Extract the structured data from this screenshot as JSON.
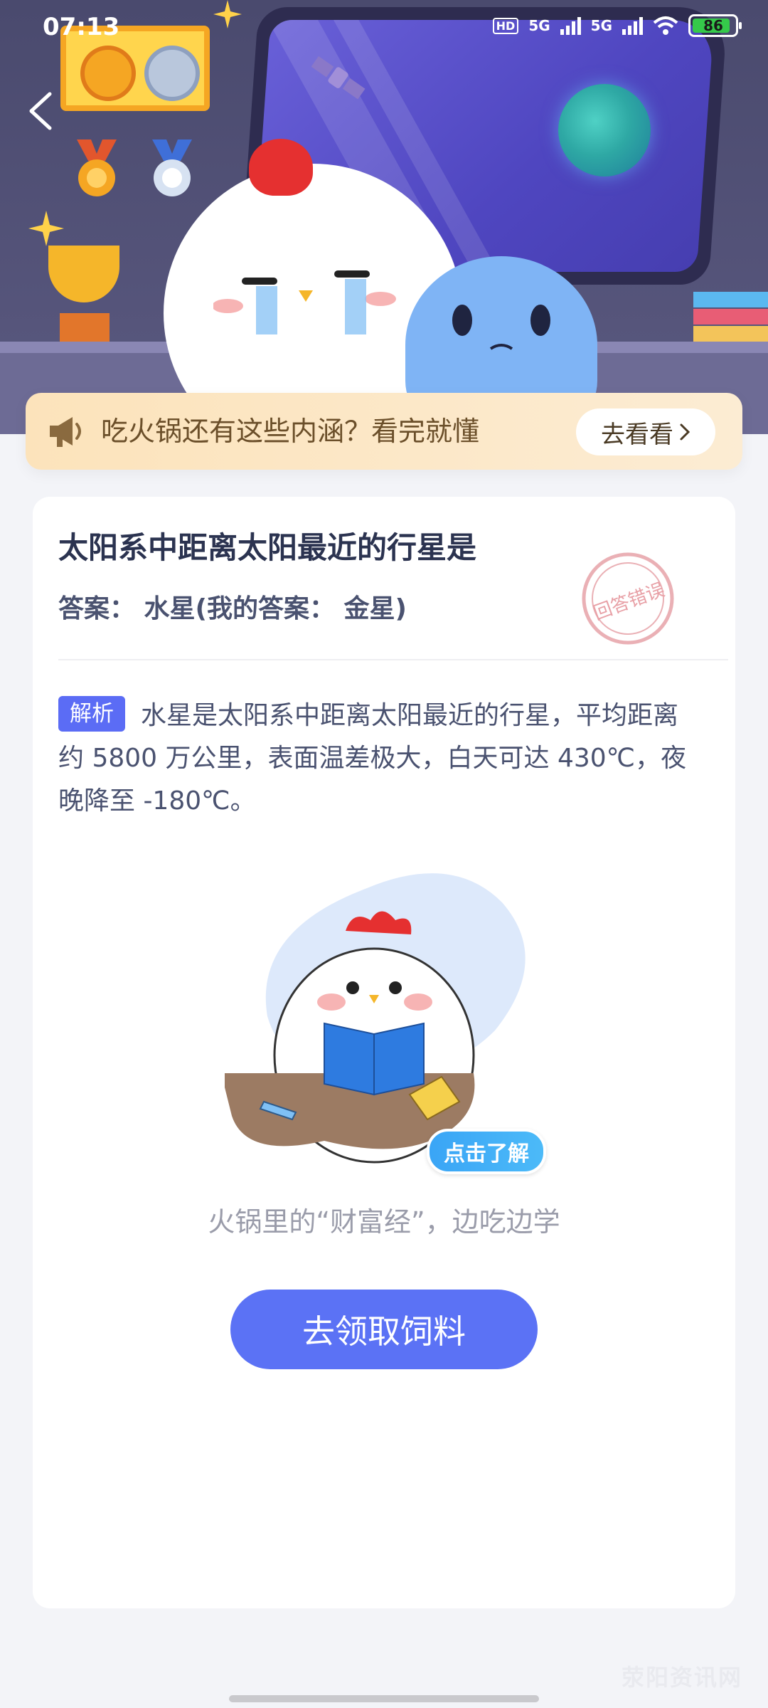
{
  "status_bar": {
    "time": "07:13",
    "hd_label": "HD",
    "network_1": "5G",
    "network_2": "5G",
    "battery": "86"
  },
  "notice": {
    "text": "吃火锅还有这些内涵？看完就懂",
    "button": "去看看"
  },
  "question": {
    "title": "太阳系中距离太阳最近的行星是",
    "answer_line": "答案： 水星(我的答案： 金星)",
    "stamp_text": "回答错误"
  },
  "explanation": {
    "tag": "解析",
    "text": "水星是太阳系中距离太阳最近的行星，平均距离约 5800 万公里，表面温差极大，白天可达 430℃，夜晚降至 -180℃。"
  },
  "promo": {
    "badge": "点击了解",
    "caption": "火锅里的“财富经”，边吃边学"
  },
  "cta": {
    "label": "去领取饲料"
  },
  "watermark": "荥阳资讯网",
  "colors": {
    "accent": "#5b72f5",
    "tag": "#5b6cf5",
    "notice_bg": "#fce3bb",
    "stamp": "#e8a0a6"
  }
}
